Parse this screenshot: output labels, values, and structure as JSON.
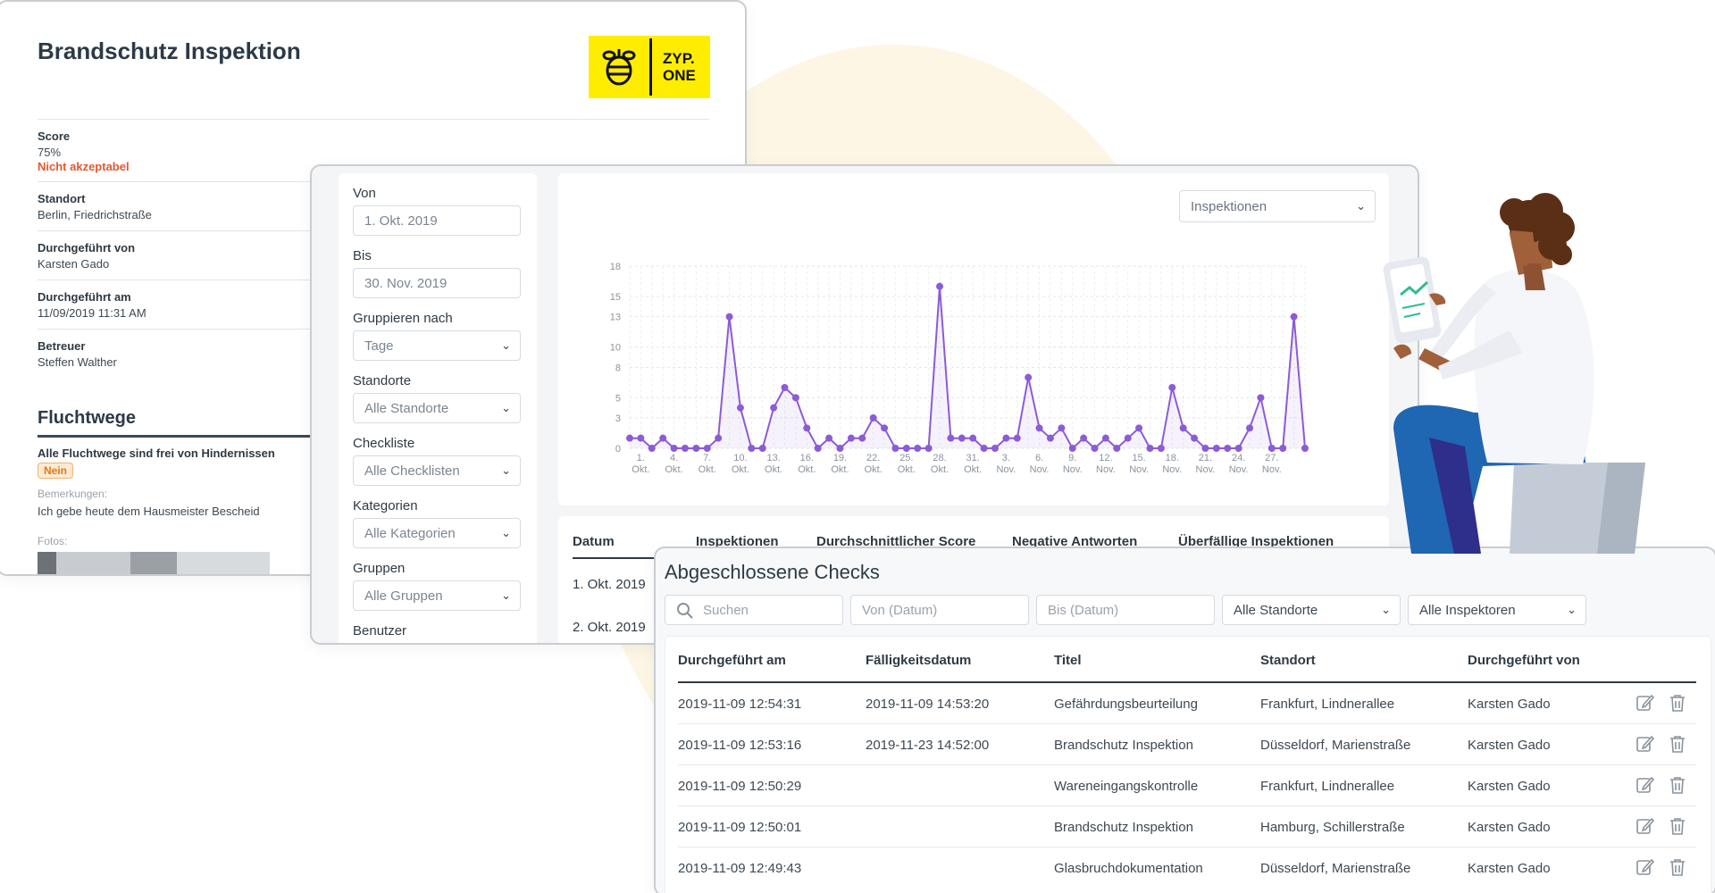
{
  "report": {
    "title": "Brandschutz Inspektion",
    "logo_text_line1": "ZYP.",
    "logo_text_line2": "ONE",
    "fields": [
      {
        "label": "Score",
        "value": "75%",
        "extra": "Nicht akzeptabel"
      },
      {
        "label": "Standort",
        "value": "Berlin, Friedrichstraße"
      },
      {
        "label": "Durchgeführt von",
        "value": "Karsten Gado"
      },
      {
        "label": "Durchgeführt am",
        "value": "11/09/2019 11:31 AM"
      },
      {
        "label": "Betreuer",
        "value": "Steffen Walther"
      }
    ],
    "section_title": "Fluchtwege",
    "question": "Alle Fluchtwege sind frei von Hindernissen",
    "answer_badge": "Nein",
    "remarks_label": "Bemerkungen:",
    "remarks_text": "Ich gebe heute dem Hausmeister Bescheid",
    "photos_label": "Fotos:"
  },
  "filters": {
    "von_label": "Von",
    "von_value": "1. Okt. 2019",
    "bis_label": "Bis",
    "bis_value": "30. Nov. 2019",
    "group_label": "Gruppieren nach",
    "group_value": "Tage",
    "standorte_label": "Standorte",
    "standorte_value": "Alle Standorte",
    "checkliste_label": "Checkliste",
    "checkliste_value": "Alle Checklisten",
    "kategorien_label": "Kategorien",
    "kategorien_value": "Alle Kategorien",
    "gruppen_label": "Gruppen",
    "gruppen_value": "Alle Gruppen",
    "benutzer_label": "Benutzer"
  },
  "chart_select": "Inspektionen",
  "chart_data": {
    "type": "line",
    "ylim": [
      0,
      18
    ],
    "yticks": [
      0,
      3,
      5,
      8,
      10,
      13,
      15,
      18
    ],
    "x_tick_labels": [
      [
        "1.",
        "Okt."
      ],
      [
        "4.",
        "Okt."
      ],
      [
        "7.",
        "Okt."
      ],
      [
        "10.",
        "Okt."
      ],
      [
        "13.",
        "Okt."
      ],
      [
        "16.",
        "Okt."
      ],
      [
        "19.",
        "Okt."
      ],
      [
        "22.",
        "Okt."
      ],
      [
        "25.",
        "Okt."
      ],
      [
        "28.",
        "Okt."
      ],
      [
        "31.",
        "Okt."
      ],
      [
        "3.",
        "Nov."
      ],
      [
        "6.",
        "Nov."
      ],
      [
        "9.",
        "Nov."
      ],
      [
        "12.",
        "Nov."
      ],
      [
        "15.",
        "Nov."
      ],
      [
        "18.",
        "Nov."
      ],
      [
        "21.",
        "Nov."
      ],
      [
        "24.",
        "Nov."
      ],
      [
        "27.",
        "Nov."
      ]
    ],
    "values": [
      1,
      1,
      0,
      1,
      0,
      0,
      0,
      0,
      1,
      13,
      4,
      0,
      0,
      4,
      6,
      5,
      2,
      0,
      1,
      0,
      1,
      1,
      3,
      2,
      0,
      0,
      0,
      0,
      16,
      1,
      1,
      1,
      0,
      0,
      1,
      1,
      7,
      2,
      1,
      2,
      0,
      1,
      0,
      1,
      0,
      1,
      2,
      0,
      0,
      6,
      2,
      1,
      0,
      0,
      0,
      0,
      2,
      5,
      0,
      0,
      13,
      0
    ],
    "color": "#8c5bd6"
  },
  "summary": {
    "headers": [
      "Datum",
      "Inspektionen",
      "Durchschnittlicher Score",
      "Negative Antworten",
      "Überfällige Inspektionen"
    ],
    "rows": [
      "1. Okt. 2019",
      "2. Okt. 2019"
    ]
  },
  "checks": {
    "title": "Abgeschlossene Checks",
    "search_placeholder": "Suchen",
    "from_placeholder": "Von (Datum)",
    "to_placeholder": "Bis (Datum)",
    "location_select": "Alle Standorte",
    "inspector_select": "Alle Inspektoren",
    "headers": [
      "Durchgeführt am",
      "Fälligkeitsdatum",
      "Titel",
      "Standort",
      "Durchgeführt von"
    ],
    "rows": [
      {
        "done": "2019-11-09 12:54:31",
        "due": "2019-11-09 14:53:20",
        "title": "Gefährdungsbeurteilung",
        "location": "Frankfurt, Lindnerallee",
        "by": "Karsten Gado"
      },
      {
        "done": "2019-11-09 12:53:16",
        "due": "2019-11-23 14:52:00",
        "title": "Brandschutz Inspektion",
        "location": "Düsseldorf, Marienstraße",
        "by": "Karsten Gado"
      },
      {
        "done": "2019-11-09 12:50:29",
        "due": "",
        "title": "Wareneingangskontrolle",
        "location": "Frankfurt, Lindnerallee",
        "by": "Karsten Gado"
      },
      {
        "done": "2019-11-09 12:50:01",
        "due": "",
        "title": "Brandschutz Inspektion",
        "location": "Hamburg, Schillerstraße",
        "by": "Karsten Gado"
      },
      {
        "done": "2019-11-09 12:49:43",
        "due": "",
        "title": "Glasbruchdokumentation",
        "location": "Düsseldorf, Marienstraße",
        "by": "Karsten Gado"
      }
    ]
  }
}
